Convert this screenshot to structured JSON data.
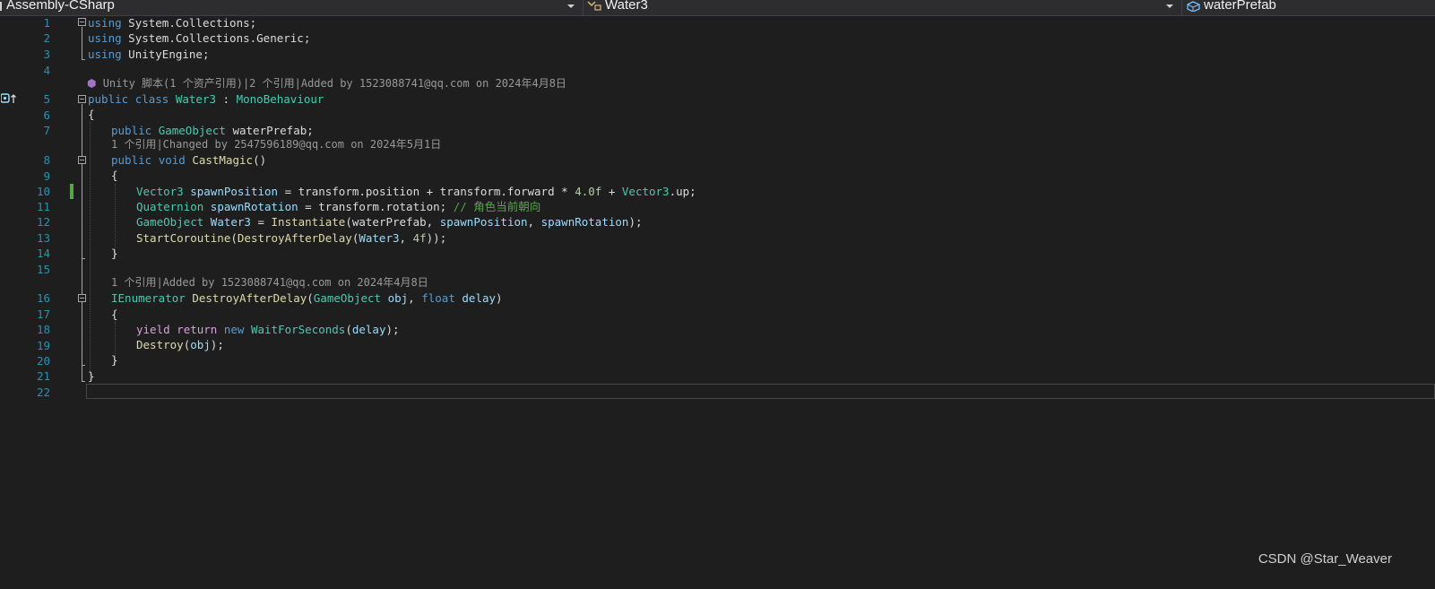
{
  "navbar": {
    "project": "Assembly-CSharp",
    "type": "Water3",
    "member": "waterPrefab"
  },
  "code_lens": {
    "class_lens": "Unity 脚本(1 个资产引用)|2 个引用|Added by 1523088741@qq.com on 2024年4月8日",
    "castmagic_lens": "1 个引用|Changed by 2547596189@qq.com on 2024年5月1日",
    "destroy_lens": "1 个引用|Added by 1523088741@qq.com on 2024年4月8日"
  },
  "line_numbers": [
    "1",
    "2",
    "3",
    "4",
    "5",
    "6",
    "7",
    "8",
    "9",
    "10",
    "11",
    "12",
    "13",
    "14",
    "15",
    "16",
    "17",
    "18",
    "19",
    "20",
    "21",
    "22"
  ],
  "code": {
    "l1": [
      "using",
      " System.Collections;"
    ],
    "l2": [
      "using",
      " System.Collections.Generic;"
    ],
    "l3": [
      "using",
      " UnityEngine;"
    ],
    "l5": [
      "public",
      " ",
      "class",
      " ",
      "Water3",
      " : ",
      "MonoBehaviour"
    ],
    "l6": [
      "{"
    ],
    "l7": [
      "public",
      " ",
      "GameObject",
      " waterPrefab;"
    ],
    "l8": [
      "public",
      " ",
      "void",
      " ",
      "CastMagic",
      "()"
    ],
    "l9": [
      "{"
    ],
    "l10": [
      "Vector3",
      " ",
      "spawnPosition",
      " = transform.position + transform.forward * ",
      "4.0f",
      " + ",
      "Vector3",
      ".up;"
    ],
    "l11": [
      "Quaternion",
      " ",
      "spawnRotation",
      " = transform.rotation; ",
      "// 角色当前朝向"
    ],
    "l12": [
      "GameObject",
      " ",
      "Water3",
      " = ",
      "Instantiate",
      "(waterPrefab, ",
      "spawnPosition",
      ", ",
      "spawnRotation",
      ");"
    ],
    "l13": [
      "StartCoroutine",
      "(",
      "DestroyAfterDelay",
      "(",
      "Water3",
      ", ",
      "4f",
      "));"
    ],
    "l14": [
      "}"
    ],
    "l16": [
      "IEnumerator",
      " ",
      "DestroyAfterDelay",
      "(",
      "GameObject",
      " ",
      "obj",
      ", ",
      "float",
      " ",
      "delay",
      ")"
    ],
    "l17": [
      "{"
    ],
    "l18": [
      "yield",
      " ",
      "return",
      " ",
      "new",
      " ",
      "WaitForSeconds",
      "(",
      "delay",
      ");"
    ],
    "l19": [
      "Destroy",
      "(",
      "obj",
      ");"
    ],
    "l20": [
      "}"
    ],
    "l21": [
      "}"
    ]
  },
  "watermark": "CSDN @Star_Weaver",
  "colors": {
    "background": "#1e1e1e",
    "keyword": "#569cd6",
    "type": "#4ec9b0",
    "comment": "#57a64a",
    "line_number": "#2b91af",
    "change_marker": "#57a64a"
  }
}
